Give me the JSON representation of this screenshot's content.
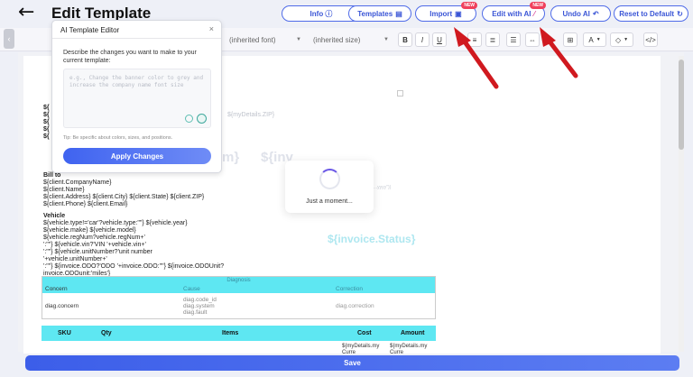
{
  "header": {
    "back_icon": "arrow-left-icon",
    "title": "Edit Template",
    "buttons": {
      "info": "Info ⓘ",
      "templates": "Templates",
      "import": "Import",
      "edit_ai": "Edit with AI",
      "undo_ai": "Undo AI",
      "reset": "Reset to Default"
    },
    "badges": {
      "import": "NEW",
      "edit_ai": "NEW"
    }
  },
  "toolbar": {
    "font_family": "(inherited font)",
    "font_size": "(inherited size)",
    "bold": "B",
    "italic": "I",
    "underline": "U",
    "text_color": "A"
  },
  "ai_editor": {
    "title": "AI Template Editor",
    "close": "×",
    "description": "Describe the changes you want to make to your current template:",
    "placeholder": "e.g., Change the banner color to grey and increase the company name font size",
    "tip": "Tip: Be specific about colors, sizes, and positions.",
    "apply_label": "Apply Changes"
  },
  "document": {
    "my_details_zip": "${myDetails.ZIP}",
    "placeholders_left": [
      "${",
      "${",
      "${",
      "${",
      "${"
    ],
    "ghost_banner_left": "m}",
    "ghost_banner_right": "${inv",
    "ghost_small": "...yyyy\")}",
    "bill_to": {
      "label": "Bill to",
      "lines": [
        "${client.CompanyName}",
        "${client.Name}",
        "${client.Address} ${client.City} ${client.State} ${client.ZIP}",
        "${client.Phone} ${client.Email}"
      ]
    },
    "vehicle": {
      "label": "Vehicle",
      "lines": [
        "${vehicle.type!='car'?vehicle.type:\"\"} ${vehicle.year}",
        "${vehicle.make} ${vehicle.model}",
        "${vehicle.regNum?vehicle.regNum+'",
        "':\"\"} ${vehicle.vin?'VIN '+vehicle.vin+'",
        "':\"\"} ${vehicle.unitNumber?'unit number",
        "'+vehicle.unitNumber+'",
        "':\"\"} ${invoice.ODO?'ODO '+invoice.ODO:\"\"} ${invoice.ODOUnit?",
        "invoice.ODOunit:'miles'}"
      ]
    },
    "invoice_status": "${invoice.Status}",
    "diagnosis": {
      "title": "Diagnosis",
      "headers": [
        "Concern",
        "Cause",
        "Correction"
      ],
      "row": {
        "concern": "diag.concern",
        "cause": [
          "diag.code_id",
          "diag.system",
          "diag.fault"
        ],
        "correction": "diag.correction"
      }
    },
    "items_table": {
      "headers": [
        "SKU",
        "Qty",
        "Items",
        "Cost",
        "Amount"
      ],
      "cost_preview": [
        "${myDetails.my",
        "Curre"
      ],
      "amount_preview": [
        "${myDetails.my",
        "Curre"
      ]
    }
  },
  "loading": {
    "text": "Just a moment..."
  },
  "save_label": "Save",
  "colors": {
    "accent": "#3f63f0",
    "annotation_arrow": "#d0191f",
    "table_header": "#5ee7f2"
  }
}
